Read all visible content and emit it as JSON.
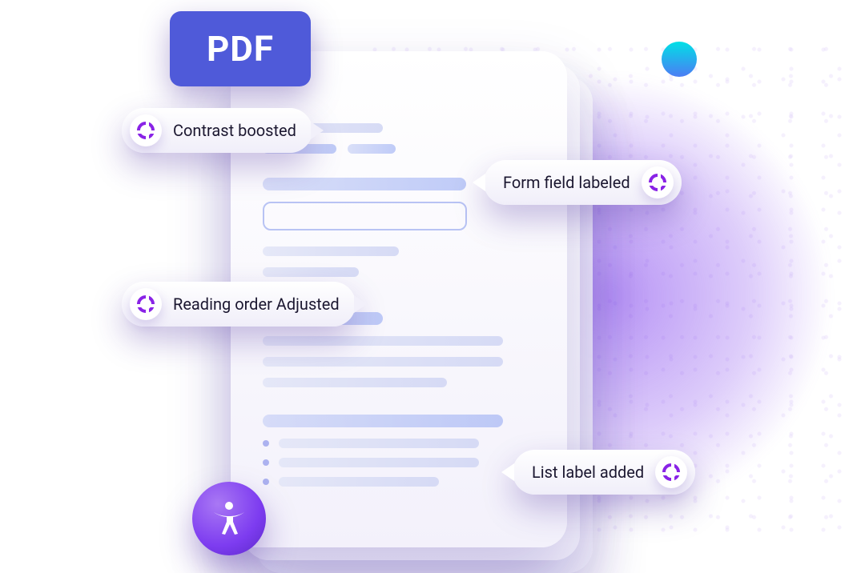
{
  "badge": {
    "label": "PDF"
  },
  "annotations": {
    "contrast": {
      "label": "Contrast boosted"
    },
    "reading": {
      "label": "Reading order Adjusted"
    },
    "formfield": {
      "label": "Form field labeled"
    },
    "listlabel": {
      "label": "List label added"
    }
  },
  "icons": {
    "annotation": "target-icon",
    "a11y": "accessibility-person-icon"
  },
  "colors": {
    "accent": "#4f5ad9",
    "glow": "#7b3aed",
    "brand": "#8923e6"
  }
}
